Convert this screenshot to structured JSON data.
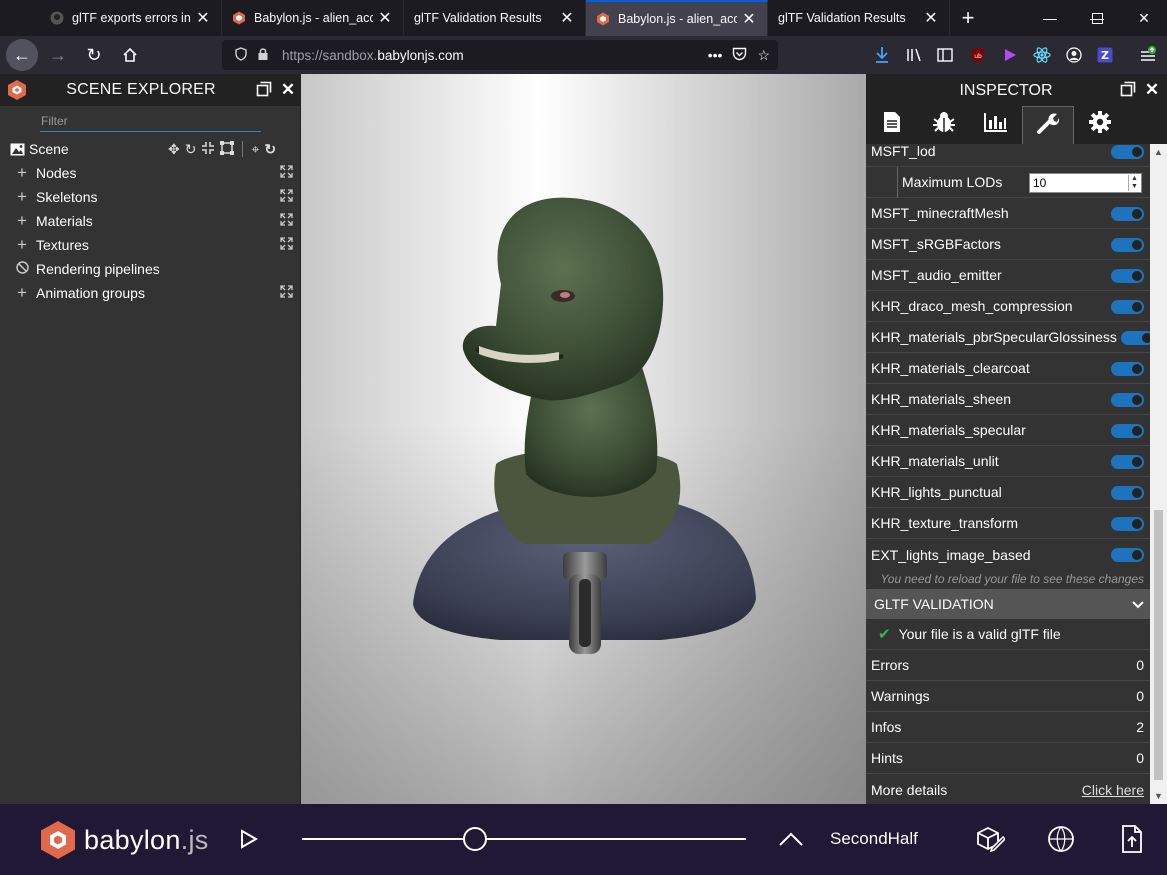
{
  "browser": {
    "tabs": [
      {
        "title": "glTF exports errors in M",
        "icon": "github-icon"
      },
      {
        "title": "Babylon.js - alien_acces",
        "icon": "babylon-icon"
      },
      {
        "title": "glTF Validation Results",
        "icon": "none"
      },
      {
        "title": "Babylon.js - alien_acces",
        "icon": "babylon-icon",
        "active": true
      },
      {
        "title": "glTF Validation Results",
        "icon": "none"
      }
    ],
    "url_prefix": "https://sandbox.",
    "url_domain": "babylonjs.com",
    "url_ellipsis": "•••"
  },
  "scene_explorer": {
    "title": "SCENE EXPLORER",
    "filter_placeholder": "Filter",
    "scene_label": "Scene",
    "items": [
      {
        "label": "Nodes",
        "icon": "plus-icon",
        "expandable": true
      },
      {
        "label": "Skeletons",
        "icon": "plus-icon",
        "expandable": true
      },
      {
        "label": "Materials",
        "icon": "plus-icon",
        "expandable": true
      },
      {
        "label": "Textures",
        "icon": "plus-icon",
        "expandable": true
      },
      {
        "label": "Rendering pipelines",
        "icon": "ban-icon",
        "expandable": false
      },
      {
        "label": "Animation groups",
        "icon": "plus-icon",
        "expandable": true
      }
    ]
  },
  "inspector": {
    "title": "INSPECTOR",
    "tabs": [
      "properties-icon",
      "debug-icon",
      "statistics-icon",
      "tools-icon",
      "settings-icon"
    ],
    "selected_tab": "tools-icon",
    "extensions": [
      {
        "name": "MSFT_lod",
        "enabled": true
      },
      {
        "name": "MSFT_minecraftMesh",
        "enabled": true
      },
      {
        "name": "MSFT_sRGBFactors",
        "enabled": true
      },
      {
        "name": "MSFT_audio_emitter",
        "enabled": true
      },
      {
        "name": "KHR_draco_mesh_compression",
        "enabled": true
      },
      {
        "name": "KHR_materials_pbrSpecularGlossiness",
        "enabled": true
      },
      {
        "name": "KHR_materials_clearcoat",
        "enabled": true
      },
      {
        "name": "KHR_materials_sheen",
        "enabled": true
      },
      {
        "name": "KHR_materials_specular",
        "enabled": true
      },
      {
        "name": "KHR_materials_unlit",
        "enabled": true
      },
      {
        "name": "KHR_lights_punctual",
        "enabled": true
      },
      {
        "name": "KHR_texture_transform",
        "enabled": true
      },
      {
        "name": "EXT_lights_image_based",
        "enabled": true
      }
    ],
    "max_lods_label": "Maximum LODs",
    "max_lods_value": "10",
    "reload_note": "You need to reload your file to see these changes",
    "validation": {
      "header": "GLTF VALIDATION",
      "status": "Your file is a valid glTF file",
      "stats": [
        {
          "label": "Errors",
          "value": "0"
        },
        {
          "label": "Warnings",
          "value": "0"
        },
        {
          "label": "Infos",
          "value": "2"
        },
        {
          "label": "Hints",
          "value": "0"
        }
      ],
      "more_details_label": "More details",
      "more_details_link": "Click here"
    }
  },
  "footer": {
    "brand_main": "babylon",
    "brand_ext": ".js",
    "animation_name": "SecondHalf",
    "slider_position": 0.39
  },
  "colors": {
    "accent": "#1e73bf",
    "footer_bg": "#201936",
    "panel_bg": "#333333",
    "header_bg": "#222222",
    "valid_check": "#3bb54a",
    "babylon_red": "#e0684b"
  }
}
